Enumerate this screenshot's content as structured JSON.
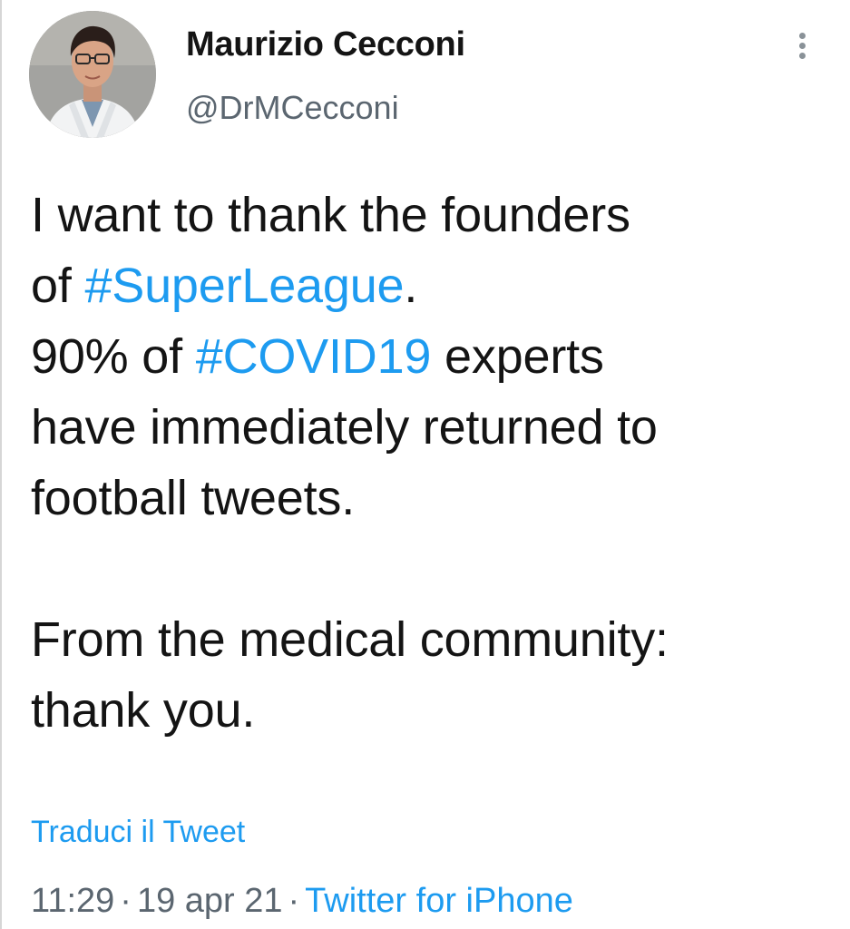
{
  "author": {
    "display_name": "Maurizio Cecconi",
    "handle": "@DrMCecconi"
  },
  "tweet": {
    "line1": "I want to thank the founders",
    "line2_prefix": "of ",
    "hashtag_superleague": "#SuperLeague",
    "line2_suffix": ".",
    "line3_prefix": "90% of ",
    "hashtag_covid": "#COVID19",
    "line3_suffix": " experts",
    "line4": "have immediately returned to",
    "line5": "football tweets.",
    "line6": "From the medical community:",
    "line7": "thank you."
  },
  "translate_label": "Traduci il Tweet",
  "meta": {
    "time": "11:29",
    "separator": "·",
    "date": "19 apr 21",
    "source": "Twitter for iPhone"
  },
  "icons": {
    "more": "more-vertical-icon"
  },
  "colors": {
    "link": "#1d9bf0",
    "text": "#141414",
    "secondary": "#5b6670"
  }
}
